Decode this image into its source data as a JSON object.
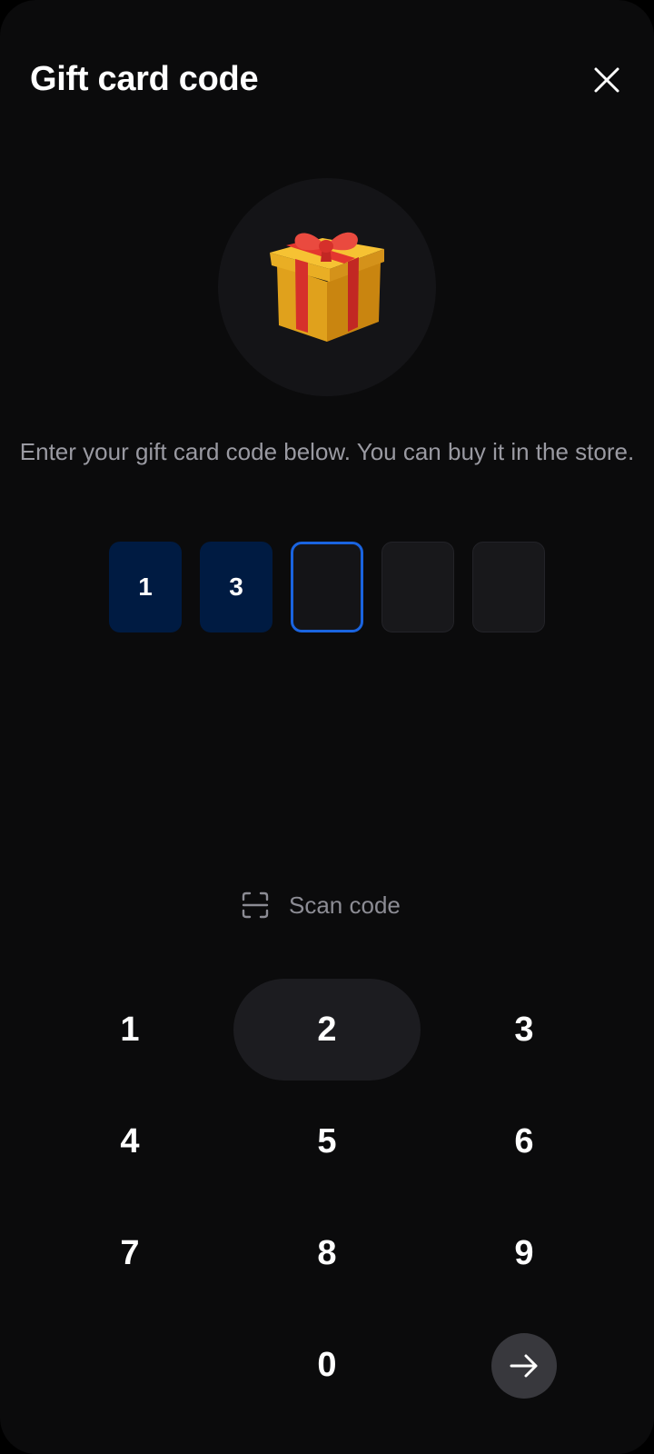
{
  "header": {
    "title": "Gift card code",
    "close_icon": "close-icon"
  },
  "hero": {
    "icon": "gift-icon"
  },
  "description": "Enter your gift card code below. You can buy it in the store.",
  "code": {
    "length": 5,
    "digits": [
      "1",
      "3",
      "",
      "",
      ""
    ],
    "active_index": 2
  },
  "scan": {
    "icon": "scan-icon",
    "label": "Scan code"
  },
  "keypad": {
    "keys": [
      "1",
      "2",
      "3",
      "4",
      "5",
      "6",
      "7",
      "8",
      "9",
      "",
      "0",
      ""
    ],
    "pressed_key": "2",
    "submit_icon": "arrow-right-icon"
  },
  "colors": {
    "background": "#0b0b0c",
    "filled_box": "#001b42",
    "active_border": "#1a64e0",
    "key_pressed": "#1c1c20",
    "submit_button": "#38383d"
  }
}
